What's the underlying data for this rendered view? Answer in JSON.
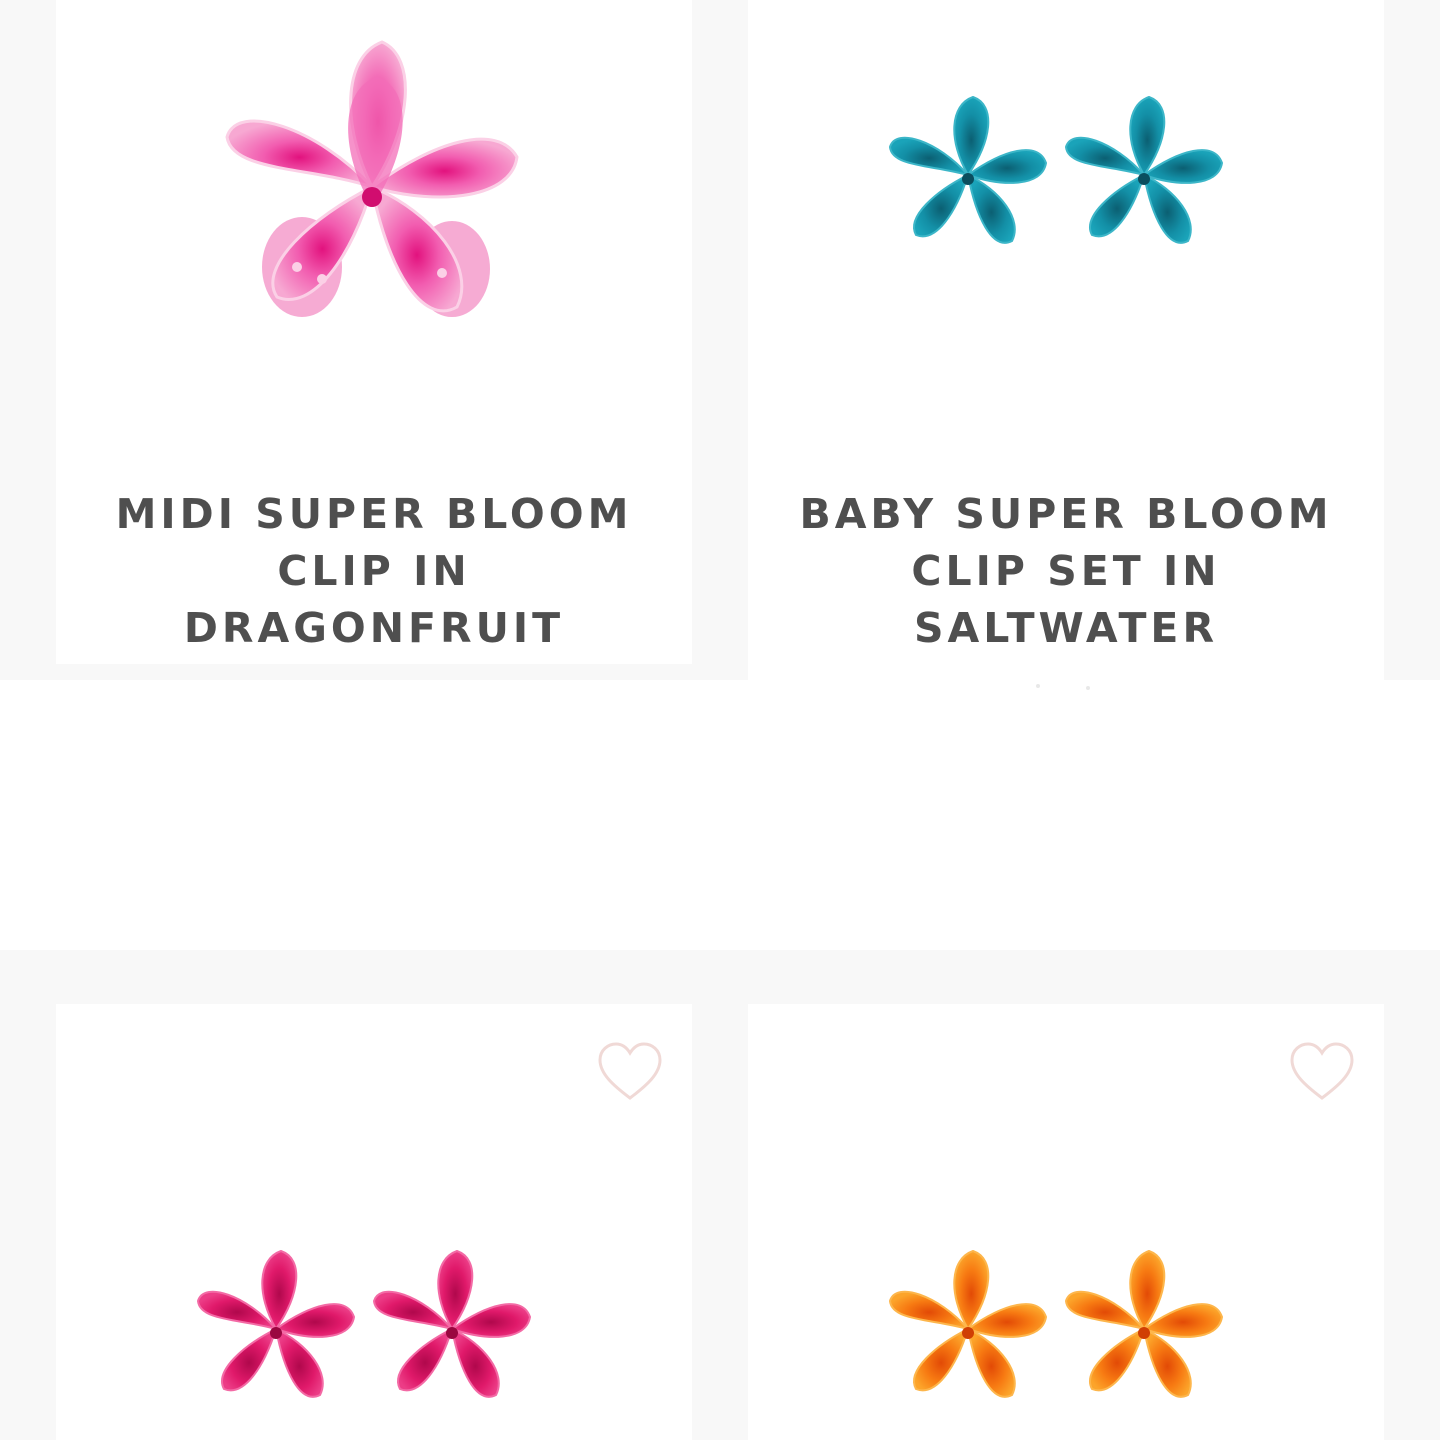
{
  "products": [
    {
      "title": "MIDI SUPER BLOOM\nCLIP IN\nDRAGONFRUIT",
      "image": "pink-flower-claw-clip",
      "color": "#f05aa8"
    },
    {
      "title": "BABY SUPER BLOOM\nCLIP SET IN\nSALTWATER",
      "image": "teal-flower-claw-clip-pair",
      "color": "#138fa6"
    },
    {
      "title": "",
      "image": "magenta-flower-claw-clip-pair",
      "color": "#e0196a",
      "wishlist_icon": "heart-outline-icon"
    },
    {
      "title": "",
      "image": "orange-flower-claw-clip-pair",
      "color": "#f77a12",
      "wishlist_icon": "heart-outline-icon"
    }
  ],
  "colors": {
    "page_background": "#f8f8f8",
    "card_background": "#ffffff",
    "title_text": "#4f4f4f",
    "heart_outline": "#f0d9d6"
  }
}
